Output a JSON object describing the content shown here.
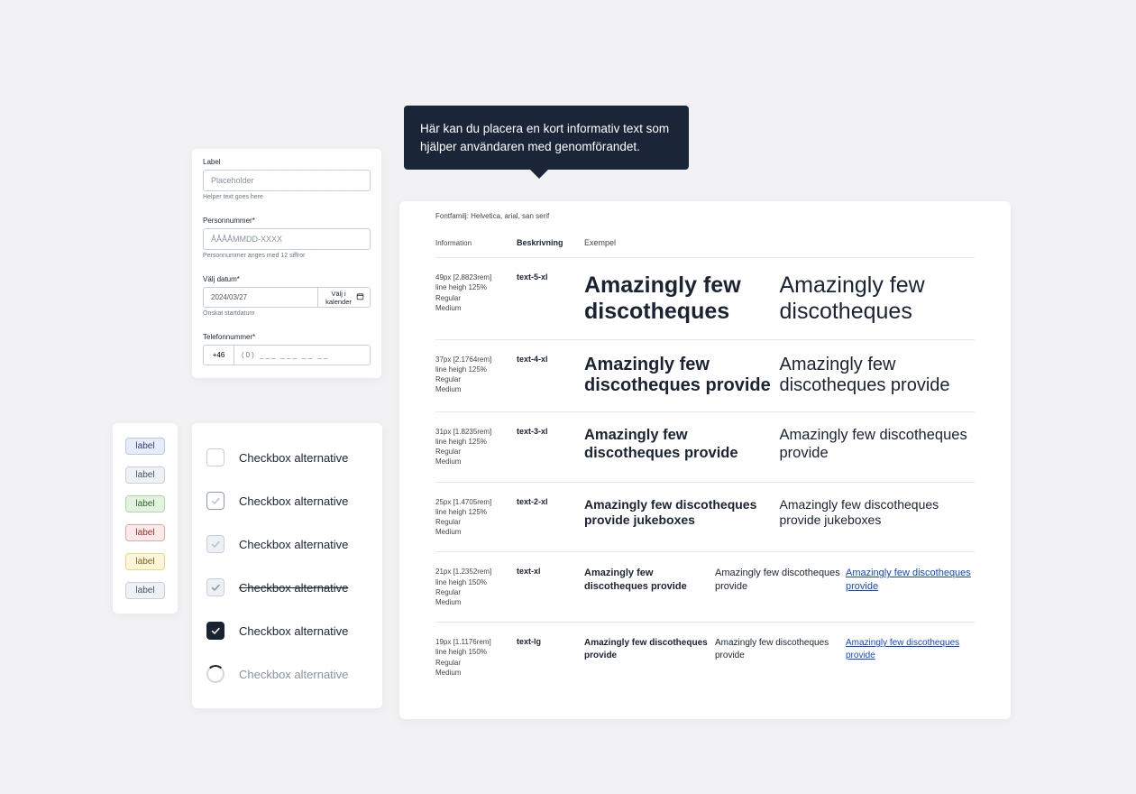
{
  "tooltip": {
    "text": "Här kan du placera en kort informativ text som hjälper användaren med genomförandet."
  },
  "inputs": {
    "label": {
      "label": "Label",
      "placeholder": "Placeholder",
      "helper": "Helper text goes here"
    },
    "personnummer": {
      "label": "Personnummer*",
      "placeholder": "ÅÅÅÅMMDD-XXXX",
      "helper": "Personnummer anges med 12 siffror"
    },
    "date": {
      "label": "Välj datum*",
      "value": "2024/03/27",
      "button": "Välj i kalender",
      "helper": "Önskat startdatum"
    },
    "phone": {
      "label": "Telefonnummer*",
      "prefix": "+46",
      "placeholder": "(0) ___ ___ __ __"
    }
  },
  "chips": [
    {
      "text": "label"
    },
    {
      "text": "label"
    },
    {
      "text": "label"
    },
    {
      "text": "label"
    },
    {
      "text": "label"
    },
    {
      "text": "label"
    }
  ],
  "checkboxes": [
    {
      "label": "Checkbox alternative"
    },
    {
      "label": "Checkbox alternative"
    },
    {
      "label": "Checkbox alternative"
    },
    {
      "label": "Checkbox alternative"
    },
    {
      "label": "Checkbox alternative"
    },
    {
      "label": "Checkbox alternative"
    }
  ],
  "typo": {
    "fontfamily": "Fontfamilj: Helvetica, arial, san serif",
    "headers": {
      "info": "Information",
      "desc": "Beskrivning",
      "examp": "Exempel"
    },
    "rows": [
      {
        "size": "49px [2.8823rem]",
        "lh": "line heigh 125%",
        "w1": "Regular",
        "w2": "Medium",
        "tag": "text-5-xl",
        "sample1": "Amazingly few discotheques",
        "sample2": "Amazingly few discotheques"
      },
      {
        "size": "37px [2.1764rem]",
        "lh": "line heigh 125%",
        "w1": "Regular",
        "w2": "Medium",
        "tag": "text-4-xl",
        "sample1": "Amazingly few discotheques provide",
        "sample2": "Amazingly few discotheques provide"
      },
      {
        "size": "31px [1.8235rem]",
        "lh": "line heigh 125%",
        "w1": "Regular",
        "w2": "Medium",
        "tag": "text-3-xl",
        "sample1": "Amazingly few discotheques provide",
        "sample2": "Amazingly few discotheques provide"
      },
      {
        "size": "25px [1.4705rem]",
        "lh": "line heigh 125%",
        "w1": "Regular",
        "w2": "Medium",
        "tag": "text-2-xl",
        "sample1": "Amazingly few discotheques provide jukeboxes",
        "sample2": "Amazingly few discotheques provide jukeboxes"
      },
      {
        "size": "21px [1.2352rem]",
        "lh": "line heigh 150%",
        "w1": "Regular",
        "w2": "Medium",
        "tag": "text-xl",
        "sample1": "Amazingly few discotheques provide",
        "sample2": "Amazingly few discotheques provide",
        "sample3": "Amazingly few discotheques provide"
      },
      {
        "size": "19px [1.1176rem]",
        "lh": "line heigh 150%",
        "w1": "Regular",
        "w2": "Medium",
        "tag": "text-lg",
        "sample1": "Amazingly few discotheques provide",
        "sample2": "Amazingly few discotheques provide",
        "sample3": "Amazingly few discotheques provide"
      }
    ]
  }
}
